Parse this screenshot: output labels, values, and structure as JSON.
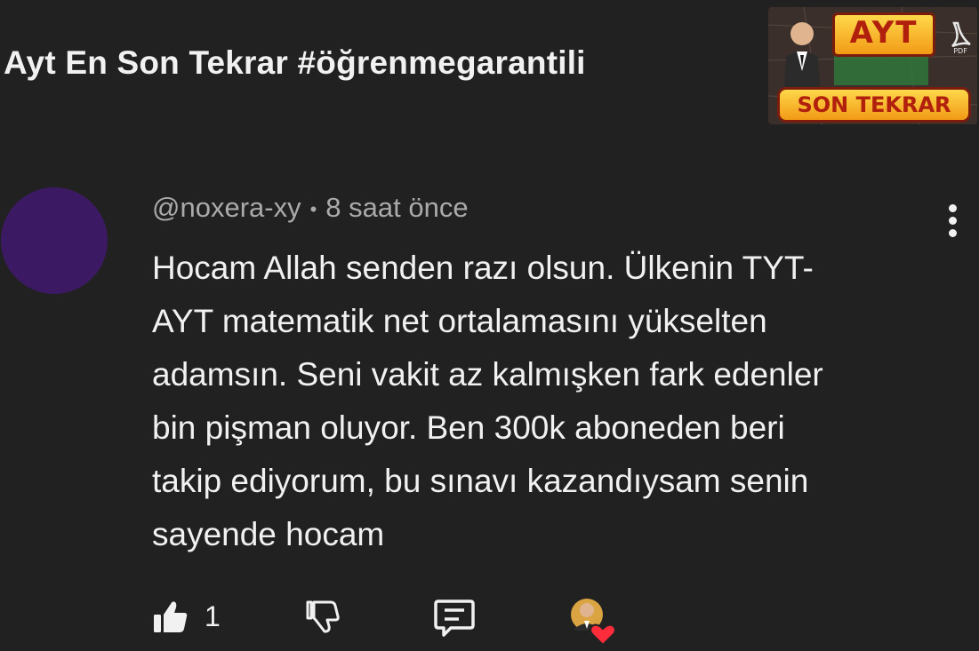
{
  "video": {
    "title": "Ayt En Son Tekrar #öğrenmegarantili",
    "thumbnail": {
      "brand_top": "AYT",
      "brand_bottom": "SON TEKRAR",
      "badge": "PDF"
    }
  },
  "comment": {
    "author": "@noxera-xy",
    "separator": "•",
    "time": "8 saat önce",
    "text_lines": [
      "Hocam Allah senden razı olsun. Ülkenin TYT-",
      "AYT matematik net ortalamasını yükselten",
      "adamsın. Seni vakit az kalmışken fark edenler",
      "bin pişman oluyor. Ben 300k aboneden beri",
      "takip ediyorum, bu sınavı kazandıysam senin",
      "sayende hocam"
    ],
    "avatar_color": "#3c1a63",
    "actions": {
      "like_icon": "thumbs-up-icon",
      "like_count": "1",
      "dislike_icon": "thumbs-down-icon",
      "reply_icon": "reply-comment-icon",
      "creator_heart_icon": "creator-heart-icon"
    },
    "menu_icon": "more-vert-icon"
  },
  "colors": {
    "background": "#212121",
    "text_primary": "#f1f1f1",
    "text_secondary": "#aaaaaa",
    "heart": "#ff2d3b"
  }
}
